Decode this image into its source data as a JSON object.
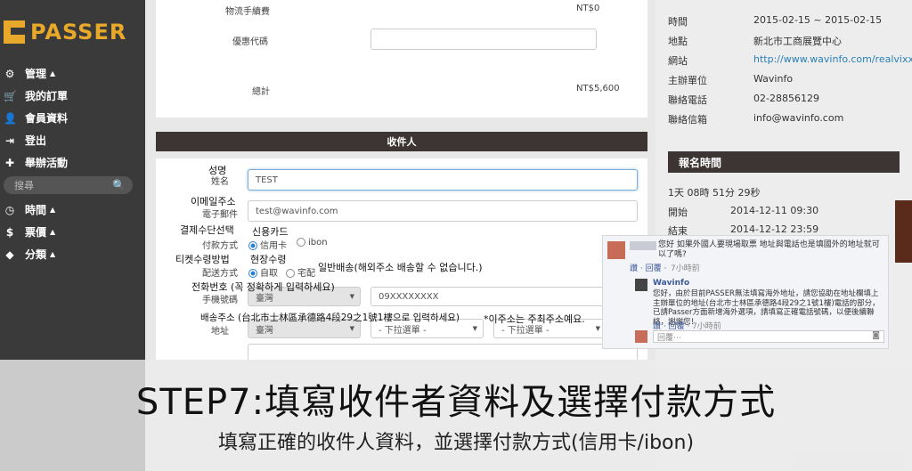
{
  "brand": {
    "name": "PASSER",
    "accent": "#e8a92a"
  },
  "nav": [
    {
      "label": "管理",
      "icon": "gear-icon"
    },
    {
      "label": "我的訂單",
      "icon": "cart-icon"
    },
    {
      "label": "會員資料",
      "icon": "user-icon"
    },
    {
      "label": "登出",
      "icon": "logout-icon"
    },
    {
      "label": "舉辦活動",
      "icon": "plus-icon"
    }
  ],
  "search": {
    "placeholder": "搜尋"
  },
  "nav2": [
    {
      "label": "時間",
      "icon": "clock-icon"
    },
    {
      "label": "票價",
      "icon": "dollar-icon"
    },
    {
      "label": "分類",
      "icon": "tag-icon"
    }
  ],
  "order": {
    "shipping_fee_label": "物流手續費",
    "shipping_fee": "NT$0",
    "coupon_label": "優惠代碼",
    "total_label": "總計",
    "total": "NT$5,600"
  },
  "recipient": {
    "header": "收件人",
    "name_label": "姓名",
    "name_value": "TEST",
    "email_label": "電子郵件",
    "email_value": "test@wavinfo.com",
    "payment_label": "付款方式",
    "payment_opt1": "信用卡",
    "payment_opt2": "ibon",
    "delivery_label": "配送方式",
    "delivery_opt1": "自取",
    "delivery_opt2": "宅配",
    "phone_label": "手機號碼",
    "phone_country": "臺灣",
    "phone_value": "09XXXXXXXX",
    "address_label": "地址",
    "address_country": "臺灣",
    "address_sel1": "- 下拉選單 -",
    "address_sel2": "- 下拉選單 -"
  },
  "annotations": {
    "name": "성명",
    "email": "이메일주소",
    "payment": "결제수단선택",
    "payment_card": "신용카드",
    "ticket": "티켓수령방법",
    "pickup": "현장수령",
    "delivery_note": "일반배송(해외주소 배송할 수 없습니다.)",
    "phone": "전화번호 (꼭 정확하게 입력하세요)",
    "address": "배송주소 (台北市士林區承德路4段29之1號1樓으로 입력하세요)",
    "address_note": "*이주소는 주최주소예요."
  },
  "event_info": [
    {
      "label": "時間",
      "value": "2015-02-15 ~ 2015-02-15"
    },
    {
      "label": "地點",
      "value": "新北市工商展覽中心"
    },
    {
      "label": "網站",
      "value": "http://www.wavinfo.com/realvixx/"
    },
    {
      "label": "主辦單位",
      "value": "Wavinfo"
    },
    {
      "label": "聯絡電話",
      "value": "02-28856129"
    },
    {
      "label": "聯絡信箱",
      "value": "info@wavinfo.com"
    }
  ],
  "reg_time": {
    "header": "報名時間",
    "remaining": "1天 08時 51分 29秒",
    "start_label": "開始",
    "start": "2014-12-11 09:30",
    "end_label": "結束",
    "end": "2014-12-12 23:59"
  },
  "fb": {
    "q_text": "您好 如果外國人要現場取票 地址與電話也是填國外的地址就可以了嗎?",
    "q_meta_reply": "讚 · 回覆 · ",
    "q_time": "7小時前",
    "a_name": "Wavinfo",
    "a_text": "您好，由於目前PASSER無法填寫海外地址，請您協助在地址欄填上主辦單位的地址(台北市士林區承德路4段29之1號1樓)電話的部分，已請Passer方面新增海外選項，請填寫正確電話號碼，以便後續聯絡，謝謝您！",
    "a_meta": "讚 · 回覆 · ",
    "a_time": "7小時前",
    "reply_placeholder": "回覆⋯"
  },
  "caption": {
    "title": "STEP7:填寫收件者資料及選擇付款方式",
    "subtitle": "填寫正確的收件人資料，並選擇付款方式(信用卡/ibon)"
  }
}
